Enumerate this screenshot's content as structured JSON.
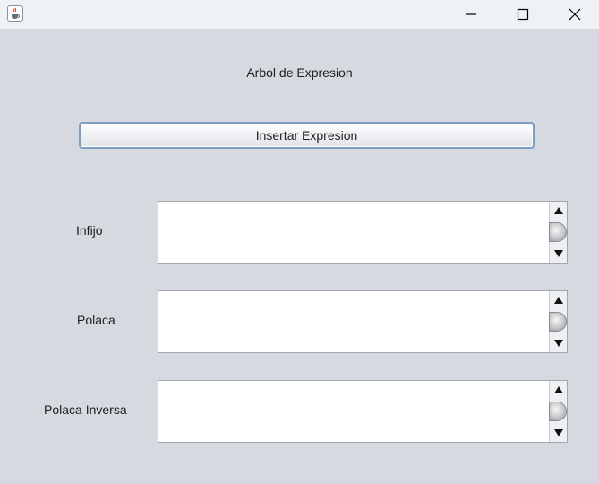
{
  "window": {
    "icon": "java-cup-icon",
    "controls": [
      "minimize-icon",
      "maximize-icon",
      "close-icon"
    ]
  },
  "main": {
    "title": "Arbol de Expresion",
    "insert_button": "Insertar Expresion",
    "fields": [
      {
        "label": "Infijo",
        "value": ""
      },
      {
        "label": "Polaca",
        "value": ""
      },
      {
        "label": "Polaca Inversa",
        "value": ""
      }
    ]
  },
  "colors": {
    "background": "#d6d9e0",
    "titlebar": "#eef1f6",
    "button_border": "#7d9ec2"
  }
}
